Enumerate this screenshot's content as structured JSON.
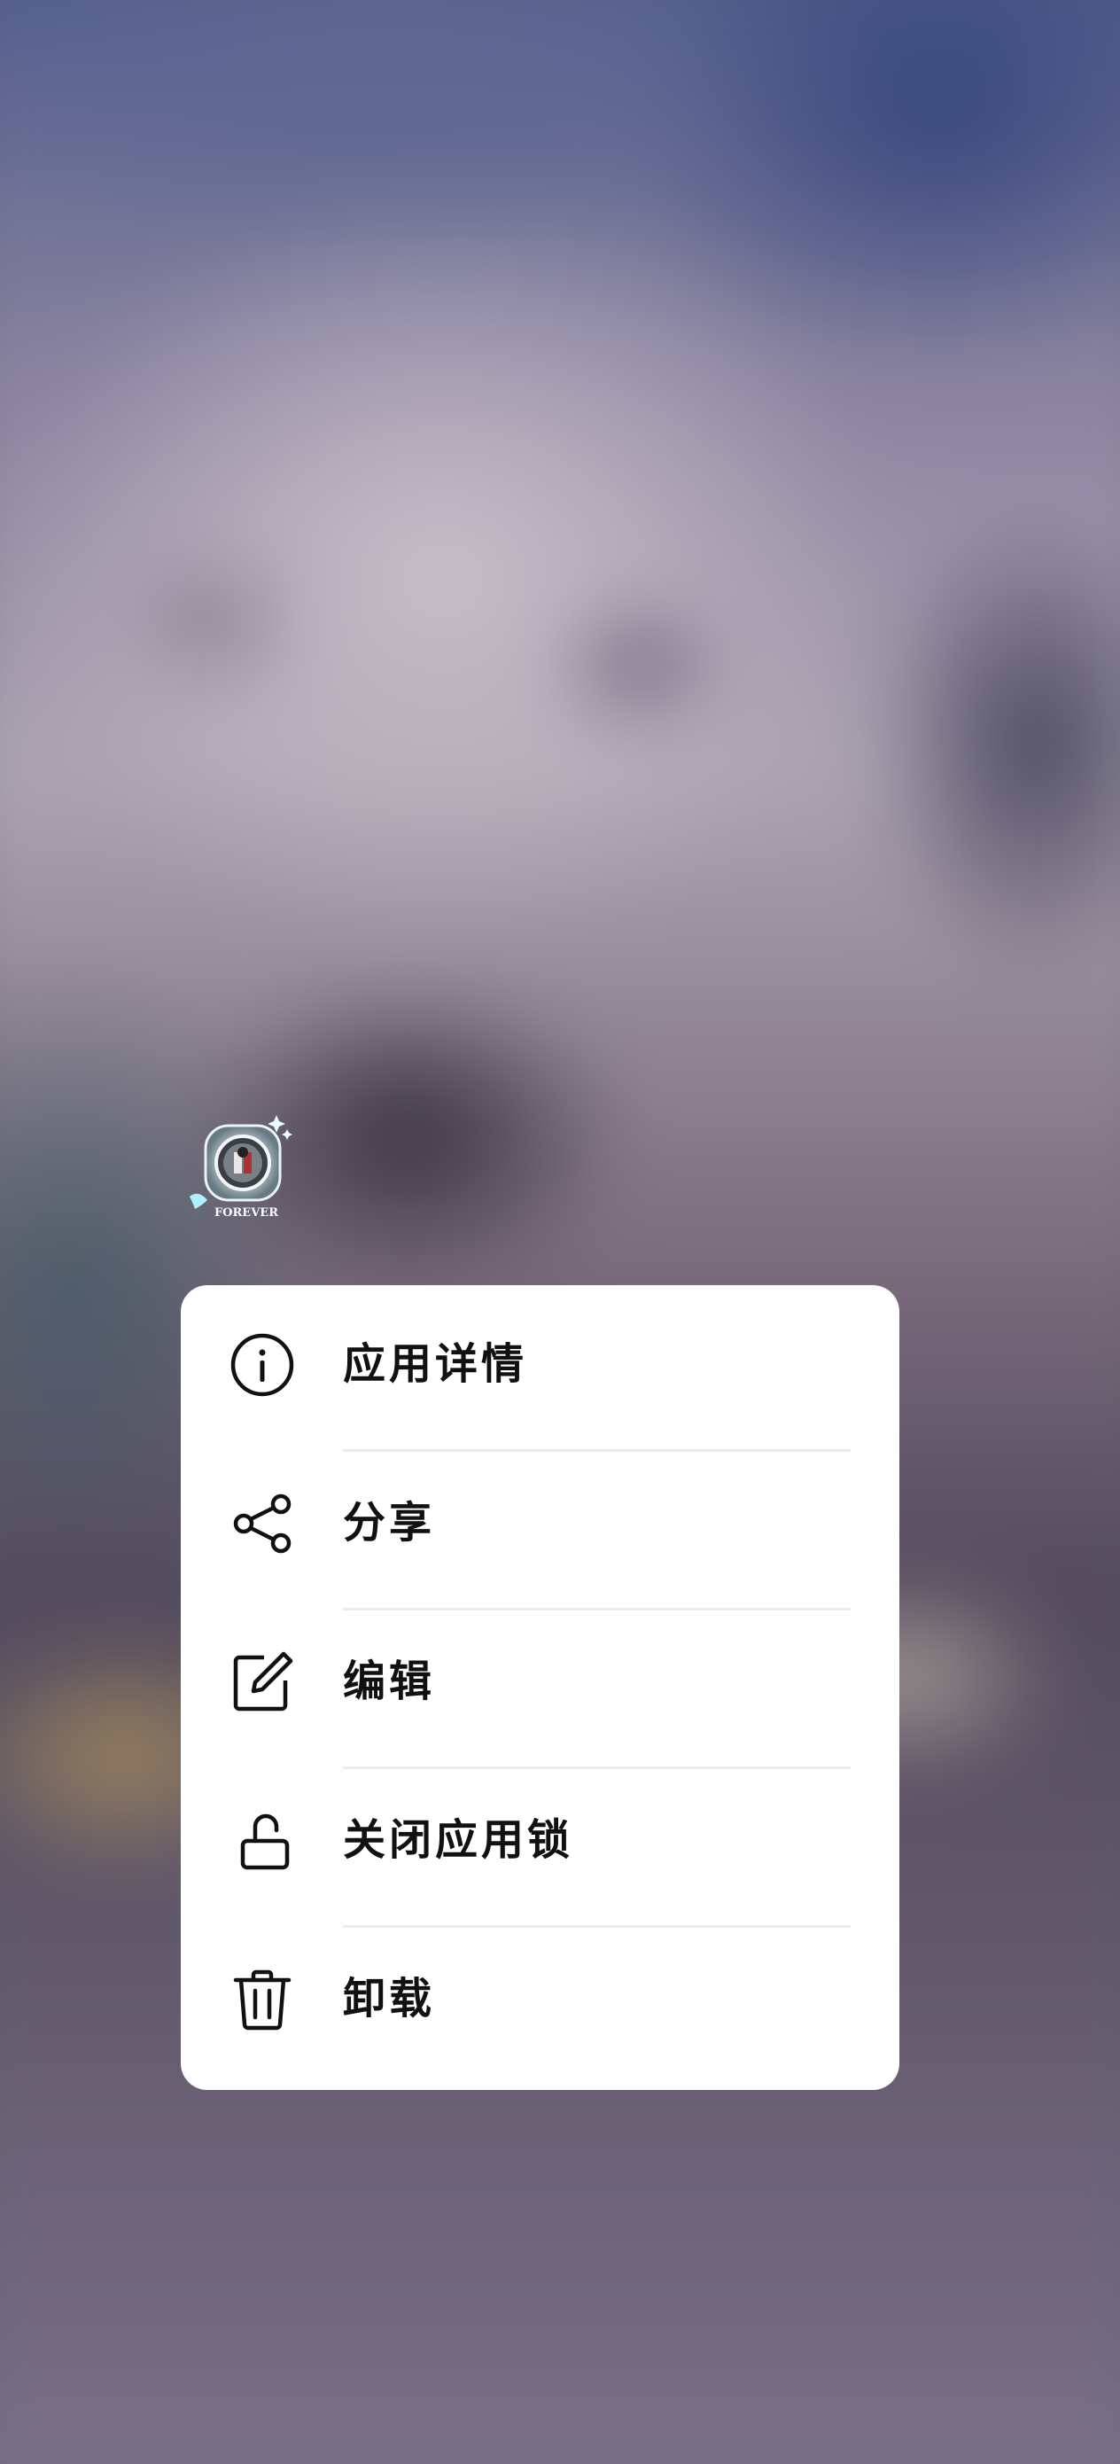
{
  "app_icon": {
    "badge_text": "FOREVER"
  },
  "menu": {
    "items": [
      {
        "label": "应用详情",
        "icon": "info-icon"
      },
      {
        "label": "分享",
        "icon": "share-icon"
      },
      {
        "label": "编辑",
        "icon": "edit-icon"
      },
      {
        "label": "关闭应用锁",
        "icon": "unlock-icon"
      },
      {
        "label": "卸载",
        "icon": "trash-icon"
      }
    ]
  },
  "colors": {
    "menu_background": "#ffffff",
    "text": "#111111",
    "divider": "#ececec"
  }
}
